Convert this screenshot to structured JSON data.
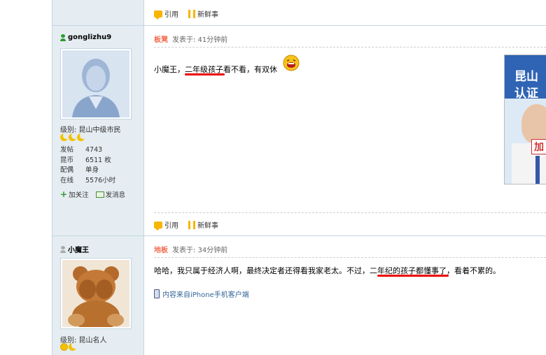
{
  "actions": {
    "quote_label": "引用",
    "fresh_label": "新鲜事"
  },
  "posts": [
    {
      "username": "gonglizhu9",
      "level_label": "级别: 昆山中级市民",
      "stats": [
        {
          "key": "发帖",
          "value": "4743"
        },
        {
          "key": "昆币",
          "value": "6511 枚"
        },
        {
          "key": "配偶",
          "value": "单身"
        },
        {
          "key": "在线",
          "value": "5576小时"
        }
      ],
      "follow_label": "加关注",
      "message_label": "发消息",
      "floor": "板凳",
      "time": "发表于: 41分钟前",
      "content": "小魔王，二年级孩子看不看，有双休"
    },
    {
      "username": "小魔王",
      "level_label": "级别: 昆山名人",
      "floor": "地板",
      "time": "发表于: 34分钟前",
      "content": "哈哈，我只属于经济人啊，最终决定者还得看我家老太。不过，二年纪的孩子都懂事了，看着不累的。",
      "mobile_label": "内容来自iPhone手机客户端"
    }
  ],
  "ad": {
    "text1": "昆山",
    "text2": "认证",
    "text3": "加"
  },
  "colors": {
    "border": "#c2d5e3",
    "sidebar": "#e5edf2",
    "floor": "#f26c4f",
    "underline": "#e00000"
  }
}
